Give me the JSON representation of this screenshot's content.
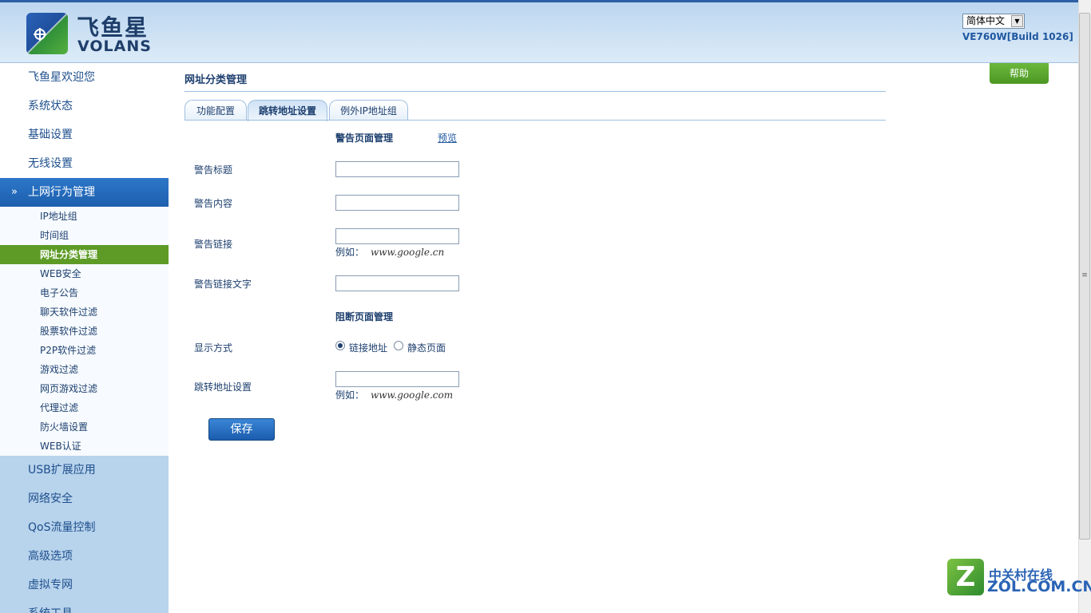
{
  "header": {
    "logo_cn": "飞鱼星",
    "logo_en": "VOLANS",
    "language": "简体中文",
    "version": "VE760W[Build 1026]"
  },
  "help_label": "帮助",
  "sidebar": {
    "main_items": [
      {
        "label": "飞鱼星欢迎您"
      },
      {
        "label": "系统状态"
      },
      {
        "label": "基础设置"
      },
      {
        "label": "无线设置"
      },
      {
        "label": "上网行为管理"
      },
      {
        "label": "USB扩展应用"
      },
      {
        "label": "网络安全"
      },
      {
        "label": "QoS流量控制"
      },
      {
        "label": "高级选项"
      },
      {
        "label": "虚拟专网"
      },
      {
        "label": "系统工具"
      }
    ],
    "sub_items": [
      {
        "label": "IP地址组"
      },
      {
        "label": "时间组"
      },
      {
        "label": "网址分类管理"
      },
      {
        "label": "WEB安全"
      },
      {
        "label": "电子公告"
      },
      {
        "label": "聊天软件过滤"
      },
      {
        "label": "股票软件过滤"
      },
      {
        "label": "P2P软件过滤"
      },
      {
        "label": "游戏过滤"
      },
      {
        "label": "网页游戏过滤"
      },
      {
        "label": "代理过滤"
      },
      {
        "label": "防火墙设置"
      },
      {
        "label": "WEB认证"
      }
    ]
  },
  "main": {
    "title": "网址分类管理",
    "tabs": [
      {
        "label": "功能配置"
      },
      {
        "label": "跳转地址设置"
      },
      {
        "label": "例外IP地址组"
      }
    ],
    "warning_section": "警告页面管理",
    "preview_link": "预览",
    "fields": {
      "warning_title": {
        "label": "警告标题",
        "value": ""
      },
      "warning_content": {
        "label": "警告内容",
        "value": ""
      },
      "warning_link": {
        "label": "警告链接",
        "value": "",
        "hint_prefix": "例如：",
        "hint_example": "www.google.cn"
      },
      "warning_link_text": {
        "label": "警告链接文字",
        "value": ""
      }
    },
    "block_section": "阻断页面管理",
    "display_mode": {
      "label": "显示方式",
      "options": [
        {
          "label": "链接地址",
          "checked": true
        },
        {
          "label": "静态页面",
          "checked": false
        }
      ]
    },
    "redirect": {
      "label": "跳转地址设置",
      "value": "",
      "hint_prefix": "例如：",
      "hint_example": "www.google.com"
    },
    "save_label": "保存"
  },
  "watermark": {
    "letter": "Z",
    "cn": "中关村在线",
    "en": "ZOL.COM.CN"
  }
}
